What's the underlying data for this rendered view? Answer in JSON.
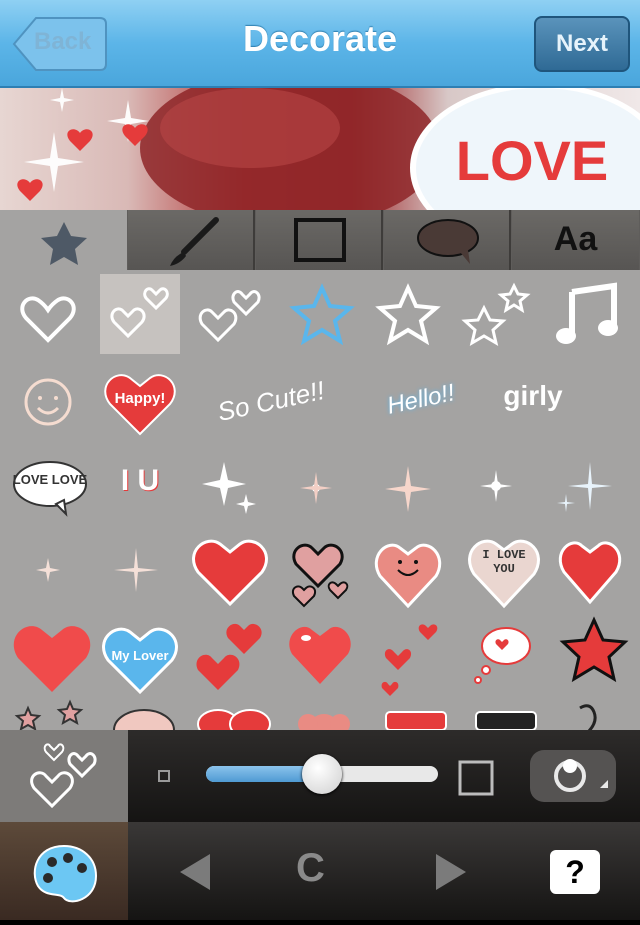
{
  "navbar": {
    "title": "Decorate",
    "back_label": "Back",
    "next_label": "Next"
  },
  "photo": {
    "sticker_text": "LOVE"
  },
  "tabs": [
    {
      "name": "stamp",
      "icon": "star-icon",
      "active": true
    },
    {
      "name": "brush",
      "icon": "brush-icon",
      "active": false
    },
    {
      "name": "frame",
      "icon": "frame-icon",
      "active": false
    },
    {
      "name": "balloon",
      "icon": "speech-balloon-icon",
      "active": false
    },
    {
      "name": "text",
      "icon": "text-icon",
      "label": "Aa",
      "active": false
    }
  ],
  "stickers": {
    "happy": "Happy!",
    "so_cute": "So Cute!!",
    "hello": "Hello!!",
    "girly": "girly",
    "love_love": "LOVE LOVE",
    "i_love_u": "I U",
    "i_love_you": "I LOVE YOU",
    "my_lover": "My Lover"
  },
  "controls": {
    "size_value": 0.5
  },
  "toolbar": {
    "center_label": "C",
    "help_label": "?"
  },
  "colors": {
    "navbar": "#5cb5e8",
    "grid_bg": "#a4a3a2",
    "accent_red": "#e53b3b",
    "accent_blue": "#5ab6ec"
  }
}
